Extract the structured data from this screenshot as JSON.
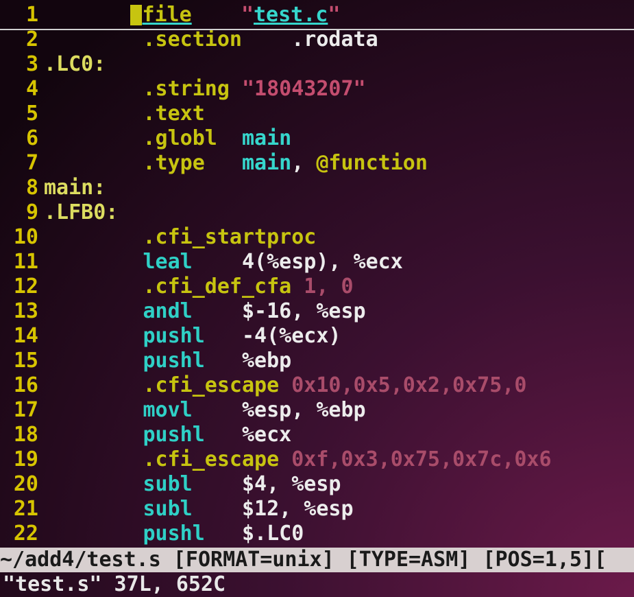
{
  "file": {
    "name_quoted": "\"test.c\"",
    "test_underlined": "test.c"
  },
  "lines": [
    {
      "n": 1
    },
    {
      "n": 2,
      "indent": "        ",
      "d": ".section",
      "plain": "    .rodata"
    },
    {
      "n": 3,
      "label": ".LC0:"
    },
    {
      "n": 4,
      "indent": "        ",
      "d": ".string",
      "str": " \"18043207\""
    },
    {
      "n": 5,
      "indent": "        ",
      "d": ".text"
    },
    {
      "n": 6,
      "indent": "        ",
      "d": ".globl",
      "id": "  main"
    },
    {
      "n": 7,
      "indent": "        ",
      "d": ".type",
      "id_main": "   main",
      "comma": ", ",
      "kw": "@function"
    },
    {
      "n": 8,
      "label": "main:"
    },
    {
      "n": 9,
      "label": ".LFB0:"
    },
    {
      "n": 10,
      "indent": "        ",
      "d": ".cfi_startproc"
    },
    {
      "n": 11,
      "indent": "        ",
      "m": "leal",
      "args": "    4(%esp), %ecx"
    },
    {
      "n": 12,
      "indent": "        ",
      "d": ".cfi_def_cfa",
      "nums": " 1, 0"
    },
    {
      "n": 13,
      "indent": "        ",
      "m": "andl",
      "args": "    $-16, %esp"
    },
    {
      "n": 14,
      "indent": "        ",
      "m": "pushl",
      "args": "   -4(%ecx)"
    },
    {
      "n": 15,
      "indent": "        ",
      "m": "pushl",
      "args": "   %ebp"
    },
    {
      "n": 16,
      "indent": "        ",
      "d": ".cfi_escape",
      "nums": " 0x10,0x5,0x2,0x75,0"
    },
    {
      "n": 17,
      "indent": "        ",
      "m": "movl",
      "args": "    %esp, %ebp"
    },
    {
      "n": 18,
      "indent": "        ",
      "m": "pushl",
      "args": "   %ecx"
    },
    {
      "n": 19,
      "indent": "        ",
      "d": ".cfi_escape",
      "nums": " 0xf,0x3,0x75,0x7c,0x6"
    },
    {
      "n": 20,
      "indent": "        ",
      "m": "subl",
      "args": "    $4, %esp"
    },
    {
      "n": 21,
      "indent": "        ",
      "m": "subl",
      "args": "    $12, %esp"
    },
    {
      "n": 22,
      "indent": "        ",
      "m": "pushl",
      "args": "   $.LC0"
    }
  ],
  "line1": {
    "indent": "       ",
    "directive_after_cursor": "file",
    "gap": "    ",
    "q1": "\"",
    "filename": "test.c",
    "q2": "\""
  },
  "status": {
    "prefix": "~/add4/test.s ",
    "format": "[FORMAT=unix]",
    "sp1": " ",
    "type": "[TYPE=ASM]",
    "sp2": " ",
    "pos": "[POS=1,5][",
    "path": "~/add4/test.s"
  },
  "command_line": "\"test.s\" 37L, 652C"
}
